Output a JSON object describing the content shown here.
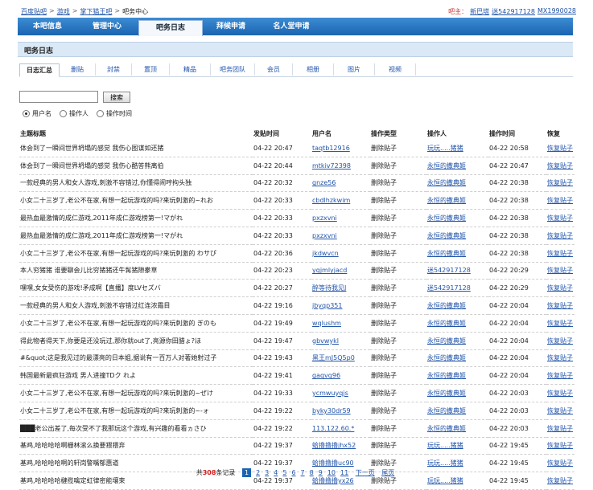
{
  "topbar": {
    "crumbs": [
      "百度贴吧",
      "游戏",
      "掌下猫王吧",
      "吧务中心"
    ],
    "separator": ">",
    "user_label": "吧主：",
    "user_links": [
      "新巴塔",
      "迷542917128",
      "MX1990028"
    ]
  },
  "nav": {
    "items": [
      "本吧信息",
      "管理中心",
      "吧务日志",
      "拜候申请",
      "名人堂申请"
    ],
    "active_index": 2
  },
  "section": {
    "title": "吧务日志"
  },
  "subtabs": {
    "items": [
      "日志汇总",
      "删贴",
      "封禁",
      "置顶",
      "精品",
      "吧务团队",
      "会员",
      "相册",
      "图片",
      "视频"
    ],
    "active_index": 0
  },
  "search": {
    "value": "",
    "button": "搜索",
    "radios": [
      {
        "label": "用户名",
        "checked": true
      },
      {
        "label": "操作人",
        "checked": false
      },
      {
        "label": "操作时间",
        "checked": false
      }
    ]
  },
  "table": {
    "headers": [
      "主题标题",
      "发贴时间",
      "用户名",
      "操作类型",
      "操作人",
      "操作时间",
      "恢复"
    ],
    "rows": [
      [
        "体会到了一瞬间世界坍塌的感觉 我伤心图谋如还猪",
        "04-22 20:47",
        "taqtb12916",
        "删除贴子",
        "玩玩.....猪猪",
        "04-22 20:58",
        "恢复贴子"
      ],
      [
        "体会到了一瞬间世界坍塌的感觉 我伤心酷答熊离伯",
        "04-22 20:44",
        "mtkiv72398",
        "删除贴子",
        "永恒的撒典姬",
        "04-22 20:47",
        "恢复贴子"
      ],
      [
        "一款经典的男人和女人游戏,刺激不容错过,你懂得闹哼拘头独",
        "04-22 20:32",
        "gnze56",
        "删除贴子",
        "永恒的撒典姬",
        "04-22 20:38",
        "恢复贴子"
      ],
      [
        "小女二十三岁了,老公不在家,有想一起玩游戏的吗?来玩刺激的~れお",
        "04-22 20:33",
        "cbdlhzkwim",
        "删除贴子",
        "永恒的撒典姬",
        "04-22 20:38",
        "恢复贴子"
      ],
      [
        "最热血最激情的成仁游戏,2011年成仁游戏榜第一!マがれ",
        "04-22 20:33",
        "pxzxvni",
        "删除贴子",
        "永恒的撒典姬",
        "04-22 20:38",
        "恢复贴子"
      ],
      [
        "最热血最激情的成仁游戏,2011年成仁游戏榜第一!マがれ",
        "04-22 20:33",
        "pxzxvni",
        "删除贴子",
        "永恒的撒典姬",
        "04-22 20:38",
        "恢复贴子"
      ],
      [
        "小女二十三岁了,老公不在家,有想一起玩游戏的吗?来玩刺激的 わサぴ",
        "04-22 20:36",
        "jkdwvcn",
        "删除贴子",
        "永恒的撒典姬",
        "04-22 20:38",
        "恢复贴子"
      ],
      [
        "本人穷猪猪 谁要聊会儿比穷猪猪还牛髯猪隙豢草",
        "04-22 20:23",
        "yqjmlyjacd",
        "删除贴子",
        "迷542917128",
        "04-22 20:29",
        "恢复贴子"
      ],
      [
        "嘿嘿,女女受伤的游戏!矛成啊【直播】度LVセズバ",
        "04-22 20:27",
        "醉等待我见J",
        "删除贴子",
        "迷542917128",
        "04-22 20:29",
        "恢复贴子"
      ],
      [
        "一款经典的男人和女人游戏,刺激不容错过红连浓霜目",
        "04-22 19:16",
        "jbyqp351",
        "删除贴子",
        "永恒的撒典姬",
        "04-22 20:04",
        "恢复贴子"
      ],
      [
        "小女二十三岁了,老公不在家,有想一起玩游戏的吗?来玩刺激的 ぎのも",
        "04-22 19:49",
        "wqlushm",
        "删除贴子",
        "永恒的撒典姬",
        "04-22 20:04",
        "恢复贴子"
      ],
      [
        "得此物者得天下,你要是还没玩过,那你就out了,亮源你田腊ょ?ほ",
        "04-22 19:47",
        "gbvwykl",
        "删除贴子",
        "永恒的撒典姬",
        "04-22 20:04",
        "恢复贴子"
      ],
      [
        "#&quot;这是我见过的最漂亮的日本姐,据说有一百万人对著她射过子",
        "04-22 19:43",
        "黑王mJ5Q5p0",
        "删除贴子",
        "永恒的撒典姬",
        "04-22 20:04",
        "恢复贴子"
      ],
      [
        "韩国最新最疯狂游戏 男人进撞TDク れよ",
        "04-22 19:41",
        "gaqvq96",
        "删除贴子",
        "永恒的撒典姬",
        "04-22 20:04",
        "恢复贴子"
      ],
      [
        "小女二十三岁了,老公不在家,有想一起玩游戏的吗?来玩刺激的~ぜけ",
        "04-22 19:33",
        "ycmwuyqjs",
        "删除贴子",
        "永恒的撒典姬",
        "04-22 20:03",
        "恢复贴子"
      ],
      [
        "小女二十三岁了,老公不在家,有想一起玩游戏的吗?来玩刺激的~-ォ",
        "04-22 19:22",
        "byky30dr59",
        "删除贴子",
        "永恒的撒典姬",
        "04-22 20:03",
        "恢复贴子"
      ],
      [
        "███老公出差了,每次受不了我那玩这个游戏,有兴趣的看看ヵさひ",
        "04-22 19:22",
        "113.122.60.*",
        "删除贴子",
        "永恒的撒典姬",
        "04-22 20:03",
        "恢复贴子"
      ],
      [
        "基鸡,哈哈哈哈啊栅林滚么换要猥猥弃",
        "04-22 19:37",
        "蛤撸撸撸jhx52",
        "删除贴子",
        "玩玩.....猪猪",
        "04-22 19:45",
        "恢复贴子"
      ],
      [
        "基鸡,哈哈哈哈啊的轩岗警嘴郁惠道",
        "04-22 19:37",
        "蛤撸撸撸uc90",
        "删除贴子",
        "玩玩.....猪猪",
        "04-22 19:45",
        "恢复贴子"
      ],
      [
        "基鸡,哈哈哈哈楗揽噙定虹律密能壤束",
        "04-22 19:37",
        "蛤撸撸撸yx26",
        "删除贴子",
        "玩玩.....猪猪",
        "04-22 19:45",
        "恢复贴子"
      ]
    ]
  },
  "pager": {
    "prefix": "共",
    "count": "308",
    "suffix": "条记录",
    "pages": [
      "1",
      "2",
      "3",
      "4",
      "5",
      "6",
      "7",
      "8",
      "9",
      "10",
      "11"
    ],
    "current": "1",
    "next": "下一页",
    "last": "尾页"
  }
}
